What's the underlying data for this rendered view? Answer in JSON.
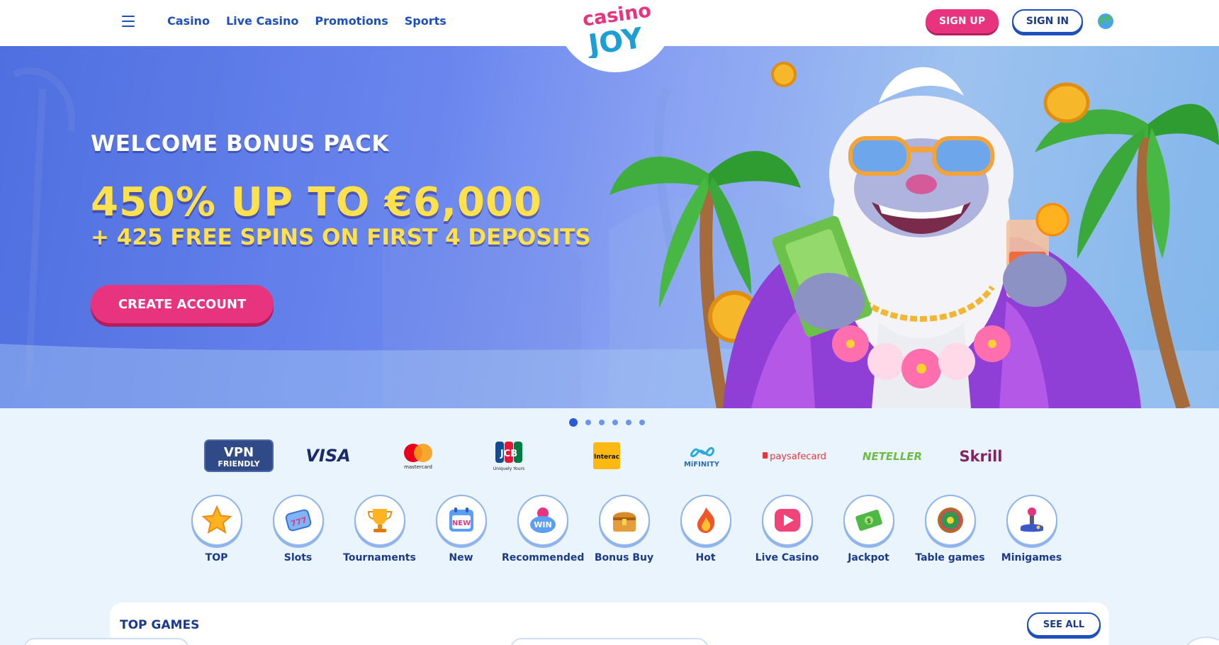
{
  "header": {
    "menu_icon": "hamburger-icon",
    "nav": [
      "Casino",
      "Live Casino",
      "Promotions",
      "Sports"
    ],
    "logo_top": "casino",
    "logo_bottom": "JOY",
    "signup_label": "SIGN UP",
    "signin_label": "SIGN IN",
    "language_icon": "globe-icon"
  },
  "hero": {
    "title": "WELCOME BONUS PACK",
    "amount": "450% UP TO €6,000",
    "subtitle": "+ 425 FREE SPINS ON FIRST 4 DEPOSITS",
    "cta_label": "CREATE ACCOUNT",
    "slides_count": 6,
    "active_slide": 1
  },
  "payments": [
    {
      "name": "vpn-friendly",
      "line1": "VPN",
      "line2": "FRIENDLY"
    },
    {
      "name": "visa",
      "text": "VISA"
    },
    {
      "name": "mastercard",
      "text": "mastercard"
    },
    {
      "name": "jcb",
      "text": "JCB",
      "caption": "Uniquely Yours"
    },
    {
      "name": "interac",
      "text": "Interac"
    },
    {
      "name": "mifinity",
      "text": "MiFINITY"
    },
    {
      "name": "paysafecard",
      "text": "paysafecard"
    },
    {
      "name": "neteller",
      "text": "NETELLER"
    },
    {
      "name": "skrill",
      "text": "Skrill"
    }
  ],
  "categories": [
    {
      "label": "TOP",
      "icon": "star-icon"
    },
    {
      "label": "Slots",
      "icon": "slot-ticket-icon"
    },
    {
      "label": "Tournaments",
      "icon": "trophy-icon"
    },
    {
      "label": "New",
      "icon": "new-calendar-icon"
    },
    {
      "label": "Recommended",
      "icon": "win-button-icon"
    },
    {
      "label": "Bonus Buy",
      "icon": "treasure-chest-icon"
    },
    {
      "label": "Hot",
      "icon": "flame-icon"
    },
    {
      "label": "Live Casino",
      "icon": "play-icon"
    },
    {
      "label": "Jackpot",
      "icon": "money-icon"
    },
    {
      "label": "Table games",
      "icon": "roulette-icon"
    },
    {
      "label": "Minigames",
      "icon": "joystick-icon"
    }
  ],
  "top_games": {
    "title": "TOP GAMES",
    "see_all_label": "SEE ALL"
  },
  "colors": {
    "brand_blue": "#1e4fbf",
    "brand_pink": "#e8337f",
    "accent_yellow": "#ffe04d",
    "page_bg": "#eaf4fc"
  }
}
